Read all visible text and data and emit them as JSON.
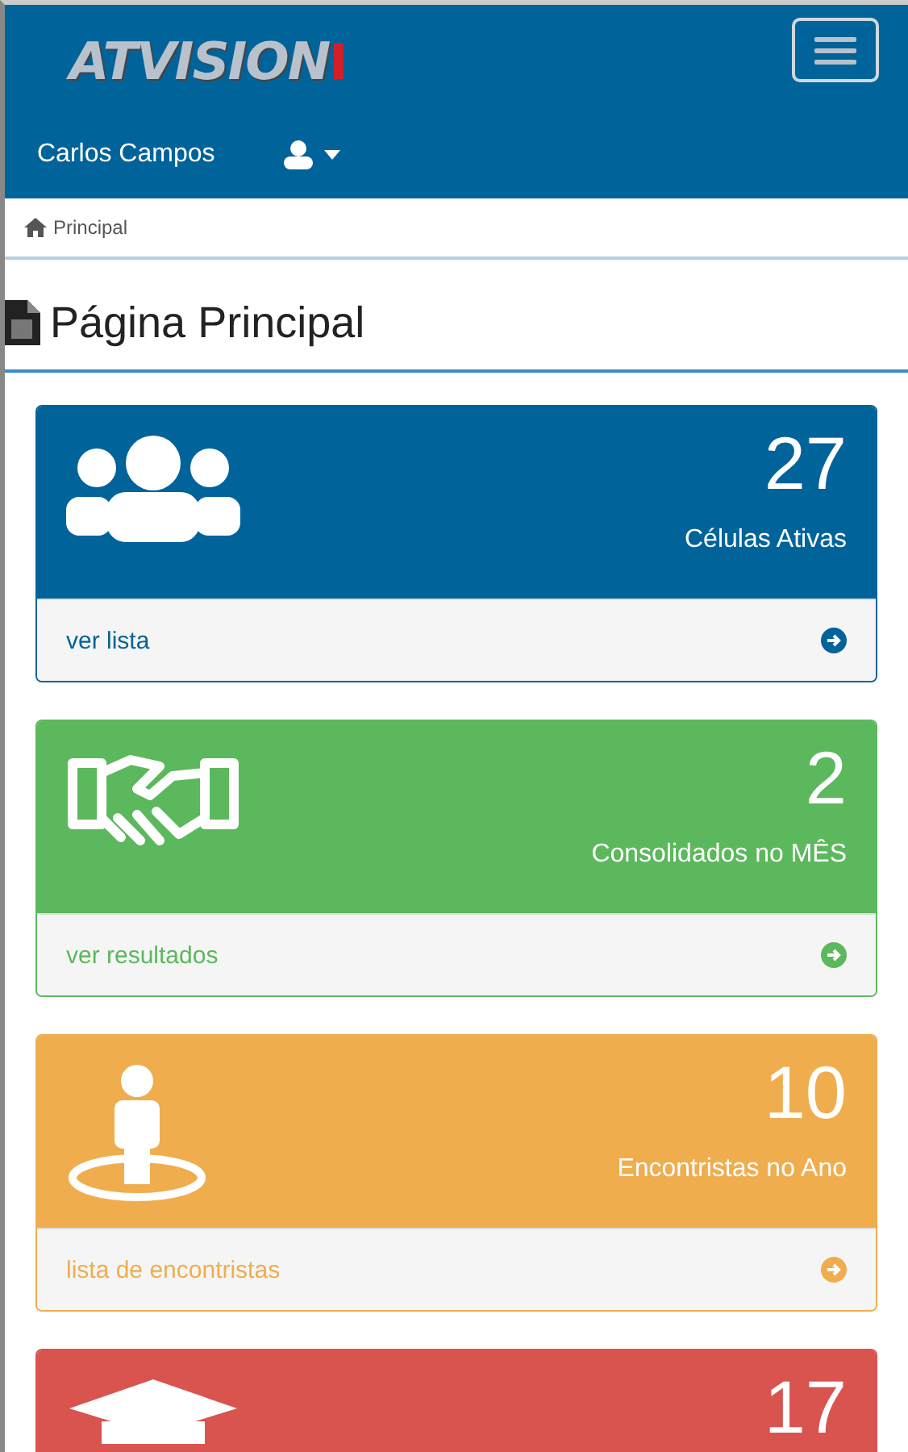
{
  "header": {
    "logo": "ATVISION",
    "user_name": "Carlos Campos"
  },
  "breadcrumb": {
    "items": [
      "Principal"
    ]
  },
  "page_title": "Página Principal",
  "panels": [
    {
      "kind": "group",
      "color": "#00639a",
      "count": "27",
      "label": "Células Ativas",
      "link": "ver lista"
    },
    {
      "kind": "handshake",
      "color": "#5cb85c",
      "count": "2",
      "label": "Consolidados no MÊS",
      "link": "ver resultados"
    },
    {
      "kind": "person",
      "color": "#f0ad4e",
      "count": "10",
      "label": "Encontristas no Ano",
      "link": "lista de encontristas"
    },
    {
      "kind": "graduation",
      "color": "#d9534f",
      "count": "17"
    }
  ]
}
